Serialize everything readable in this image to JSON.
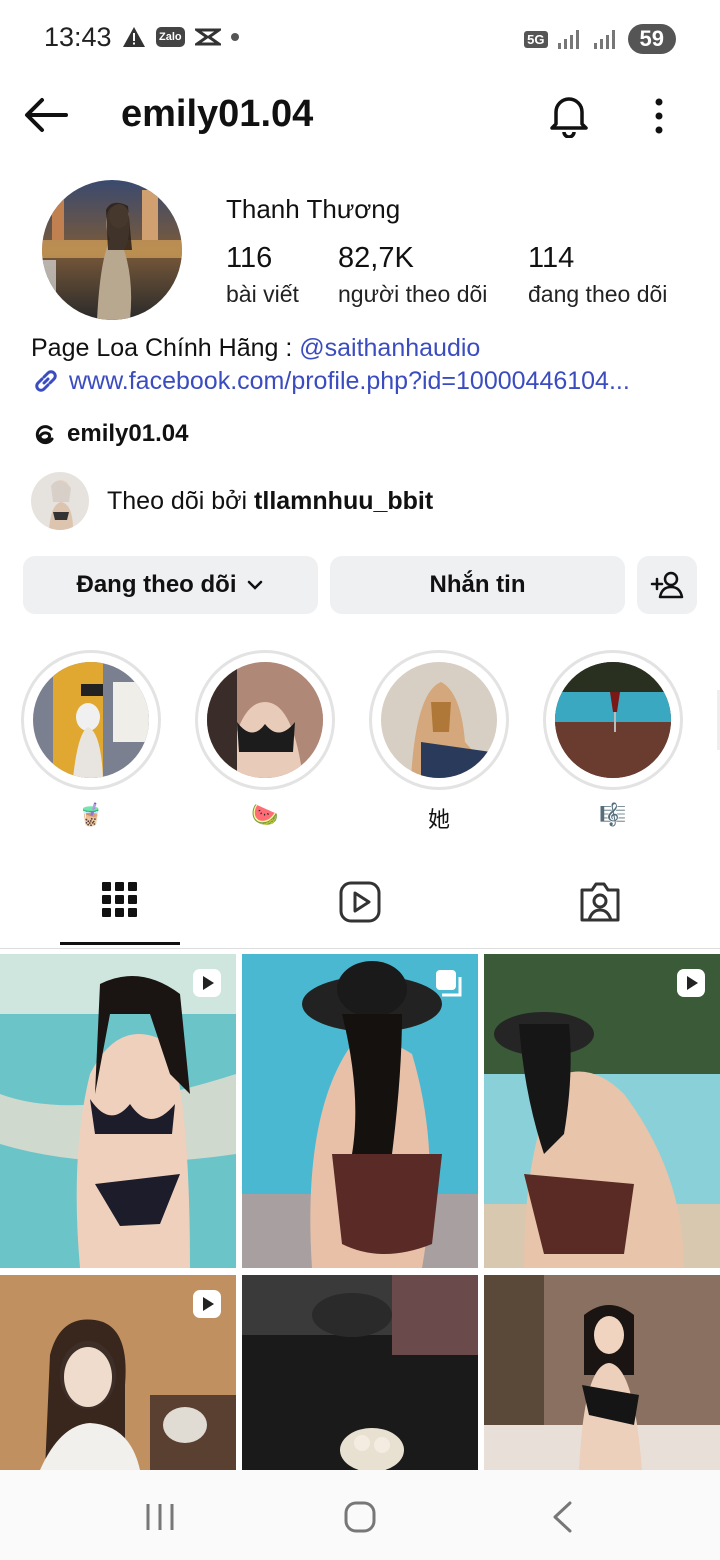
{
  "status_bar": {
    "time": "13:43",
    "network": "5G",
    "battery": "59"
  },
  "header": {
    "username": "emily01.04"
  },
  "profile": {
    "full_name": "Thanh Thương",
    "stats": [
      {
        "value": "116",
        "label": "bài viết"
      },
      {
        "value": "82,7K",
        "label": "người theo dõi"
      },
      {
        "value": "114",
        "label": "đang theo dõi"
      }
    ],
    "bio_text": "Page Loa Chính Hãng : ",
    "bio_mention": "@saithanhaudio",
    "link": "www.facebook.com/profile.php?id=10000446104...",
    "threads_handle": "emily01.04",
    "followed_by_prefix": "Theo dõi bởi ",
    "followed_by_user": "tllamnhuu_bbit"
  },
  "actions": {
    "following": "Đang theo dõi",
    "message": "Nhắn tin"
  },
  "highlights": [
    {
      "label": "🧋"
    },
    {
      "label": "🍉"
    },
    {
      "label": "她"
    },
    {
      "label": "🎼"
    }
  ],
  "colors": {
    "link": "#3b4cc0",
    "button_bg": "#eff0f2"
  }
}
